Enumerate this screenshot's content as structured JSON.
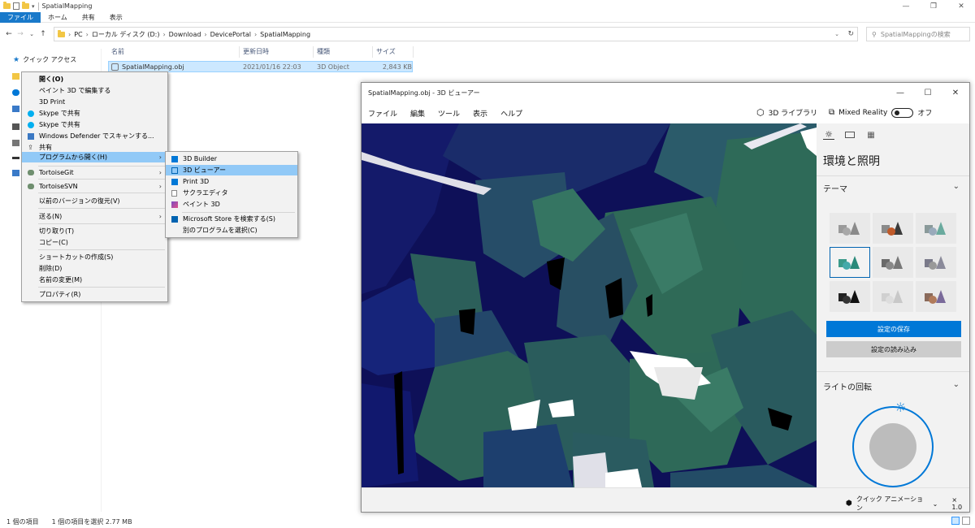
{
  "explorer": {
    "title": "SpatialMapping",
    "ribbon_tabs": [
      "ファイル",
      "ホーム",
      "共有",
      "表示"
    ],
    "breadcrumb": [
      "PC",
      "ローカル ディスク (D:)",
      "Download",
      "DevicePortal",
      "SpatialMapping"
    ],
    "search_placeholder": "SpatialMappingの検索",
    "nav_quick_access": "クイック アクセス",
    "columns": {
      "name": "名前",
      "modified": "更新日時",
      "type": "種類",
      "size": "サイズ"
    },
    "file": {
      "name": "SpatialMapping.obj",
      "modified": "2021/01/16 22:03",
      "type": "3D Object",
      "size": "2,843 KB"
    },
    "status": {
      "count": "1 個の項目",
      "selected": "1 個の項目を選択  2.77 MB"
    }
  },
  "context_menu": {
    "open": "開く(O)",
    "paint3d_edit": "ペイント 3D で編集する",
    "print3d": "3D Print",
    "skype1": "Skype で共有",
    "skype2": "Skype で共有",
    "defender": "Windows Defender でスキャンする...",
    "share": "共有",
    "open_with": "プログラムから開く(H)",
    "tortoisegit": "TortoiseGit",
    "tortoisesvn": "TortoiseSVN",
    "restore": "以前のバージョンの復元(V)",
    "send_to": "送る(N)",
    "cut": "切り取り(T)",
    "copy": "コピー(C)",
    "shortcut": "ショートカットの作成(S)",
    "delete": "削除(D)",
    "rename": "名前の変更(M)",
    "properties": "プロパティ(R)"
  },
  "submenu": {
    "builder": "3D Builder",
    "viewer": "3D ビューアー",
    "print3d": "Print 3D",
    "sakura": "サクラエディタ",
    "paint3d": "ペイント 3D",
    "store": "Microsoft Store を検索する(S)",
    "other": "別のプログラムを選択(C)"
  },
  "viewer": {
    "title": "SpatialMapping.obj - 3D ビューアー",
    "menu": [
      "ファイル",
      "編集",
      "ツール",
      "表示",
      "ヘルプ"
    ],
    "library": "3D ライブラリ",
    "mixed_reality": "Mixed Reality",
    "mr_state": "オフ",
    "panel_title": "環境と照明",
    "theme_label": "テーマ",
    "save_settings": "設定の保存",
    "load_settings": "設定の読み込み",
    "light_rotation": "ライトの回転",
    "quick_anim": "クイック アニメーション",
    "speed": "× 1.0"
  },
  "colors": {
    "accent": "#0078d7",
    "scene_bg": "#0e1058",
    "mesh_green": "#2e6a58",
    "selection": "#cce8ff"
  }
}
